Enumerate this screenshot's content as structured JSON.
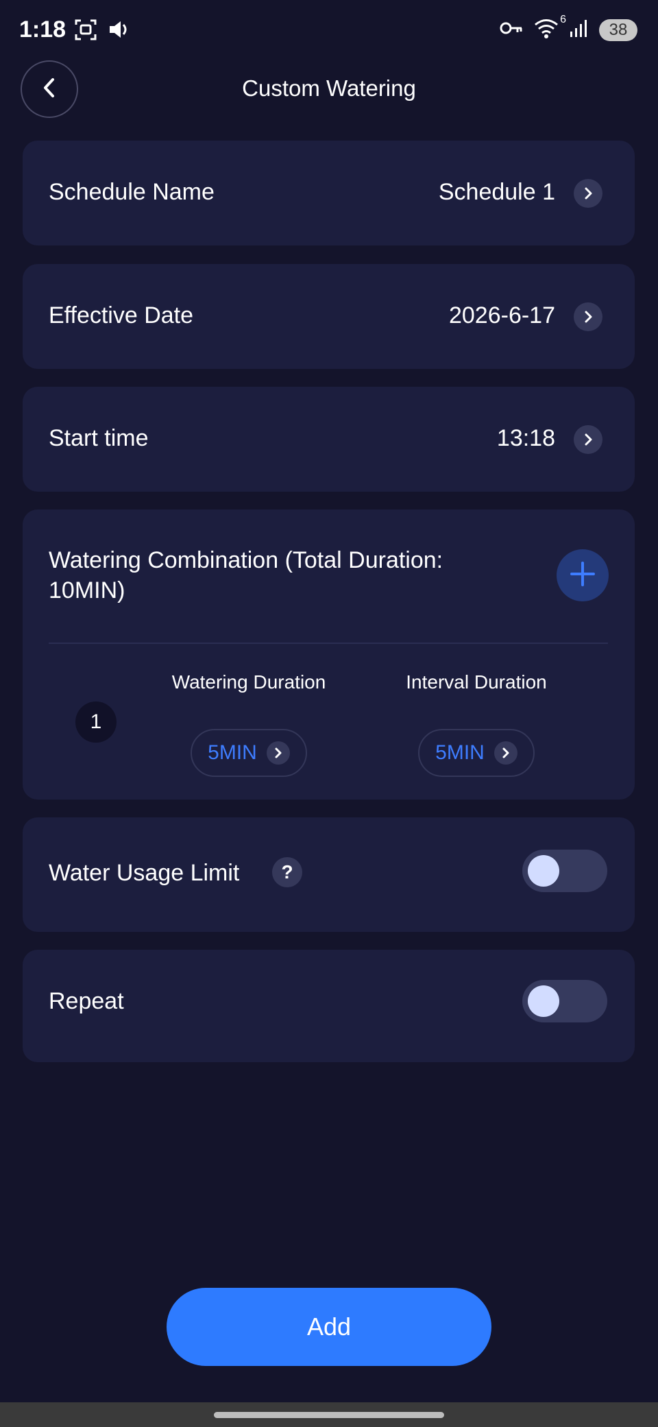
{
  "status_bar": {
    "time": "1:18",
    "battery": "38",
    "wifi_badge": "6",
    "icons": [
      "screenshot-icon",
      "volume-icon",
      "key-icon",
      "wifi-icon",
      "signal-icon",
      "battery-icon"
    ]
  },
  "header": {
    "title": "Custom Watering",
    "back_icon": "chevron-left-icon"
  },
  "rows": {
    "schedule_name": {
      "label": "Schedule Name",
      "value": "Schedule 1"
    },
    "effective_date": {
      "label": "Effective Date",
      "value": "2026-6-17"
    },
    "start_time": {
      "label": "Start time",
      "value": "13:18"
    }
  },
  "combination": {
    "title": "Watering Combination (Total Duration: 10MIN)",
    "watering_header": "Watering Duration",
    "interval_header": "Interval Duration",
    "steps": [
      {
        "number": "1",
        "watering": "5MIN",
        "interval": "5MIN"
      }
    ]
  },
  "water_usage_limit": {
    "label": "Water Usage Limit",
    "help": "?",
    "enabled": false
  },
  "repeat": {
    "label": "Repeat",
    "enabled": false
  },
  "actions": {
    "add_label": "Add"
  },
  "colors": {
    "background": "#14142b",
    "card": "#1c1e3e",
    "accent": "#2e7bff",
    "value_blue": "#3e7dff"
  }
}
